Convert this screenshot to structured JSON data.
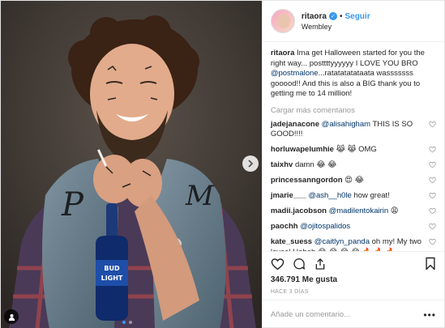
{
  "header": {
    "username": "ritaora",
    "separator": "•",
    "follow_label": "Seguir",
    "location": "Wembley",
    "avatar_icon": "profile-avatar"
  },
  "caption": {
    "username": "ritaora",
    "text_1": "Ima get Halloween started for you the right way... posttttyyyyyy I LOVE YOU BRO ",
    "mention": "@postmalone",
    "text_2": "...ratatatatataata wasssssss gooood!! And this is also a BIG thank you to getting me to 14 million!"
  },
  "load_more": "Cargar más comentarios",
  "comments": [
    {
      "user": "jadejanacone",
      "mention": "@alisahigham",
      "text": " THIS IS SO GOOD!!!!"
    },
    {
      "user": "horluwapelumhie",
      "mention": "",
      "text": "😹 😹  OMG"
    },
    {
      "user": "taixhv",
      "mention": "",
      "text": "damn 😂 😂"
    },
    {
      "user": "princessanngordon",
      "mention": "",
      "text": "😍 😂"
    },
    {
      "user": "jmarie___",
      "mention": "@ash__h0le",
      "text": " how great!"
    },
    {
      "user": "madii.jacobson",
      "mention": "@madilentokairin",
      "text": " 😩"
    },
    {
      "user": "paochh",
      "mention": "@ojitospalidos",
      "text": ""
    },
    {
      "user": "kate_suess",
      "mention": "@caitlyn_panda",
      "text": " oh my! My two loves! Hahah 😂 😂 😂 😂 🔥 🔥 🔥"
    }
  ],
  "actions": {
    "like_icon": "heart-icon",
    "comment_icon": "comment-icon",
    "share_icon": "share-icon",
    "save_icon": "bookmark-icon"
  },
  "likes": "346.791 Me gusta",
  "timestamp": "HACE 3 DÍAS",
  "add_comment_placeholder": "Añade un comentario...",
  "more_options": "•••",
  "colors": {
    "link_blue": "#3897f0",
    "mention_blue": "#003569",
    "muted": "#999999",
    "border": "#efefef"
  }
}
